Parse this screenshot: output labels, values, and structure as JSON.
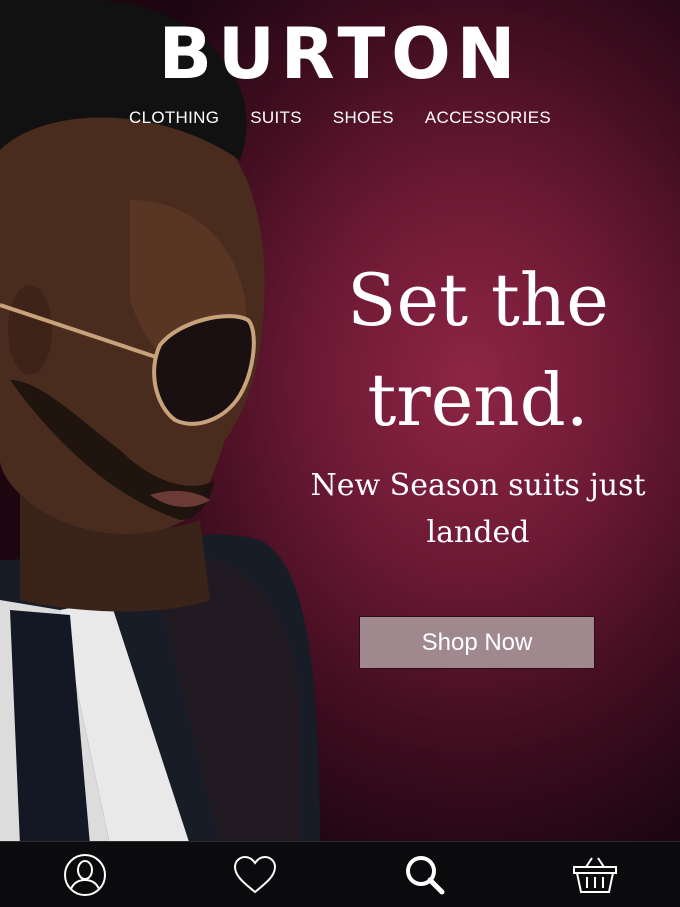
{
  "brand": {
    "logo_text": "BURTON"
  },
  "nav": {
    "items": [
      "CLOTHING",
      "SUITS",
      "SHOES",
      "ACCESSORIES"
    ]
  },
  "hero": {
    "headline_line1": "Set the",
    "headline_line2": "trend.",
    "subhead_line1": "New Season suits just",
    "subhead_line2": "landed",
    "cta_label": "Shop Now"
  },
  "tabbar": {
    "icons": [
      "account-icon",
      "heart-icon",
      "search-icon",
      "basket-icon"
    ]
  },
  "colors": {
    "background": "#6e1a35",
    "cta_background": "#a0888f",
    "tabbar": "#0b0b0e",
    "text": "#ffffff"
  }
}
